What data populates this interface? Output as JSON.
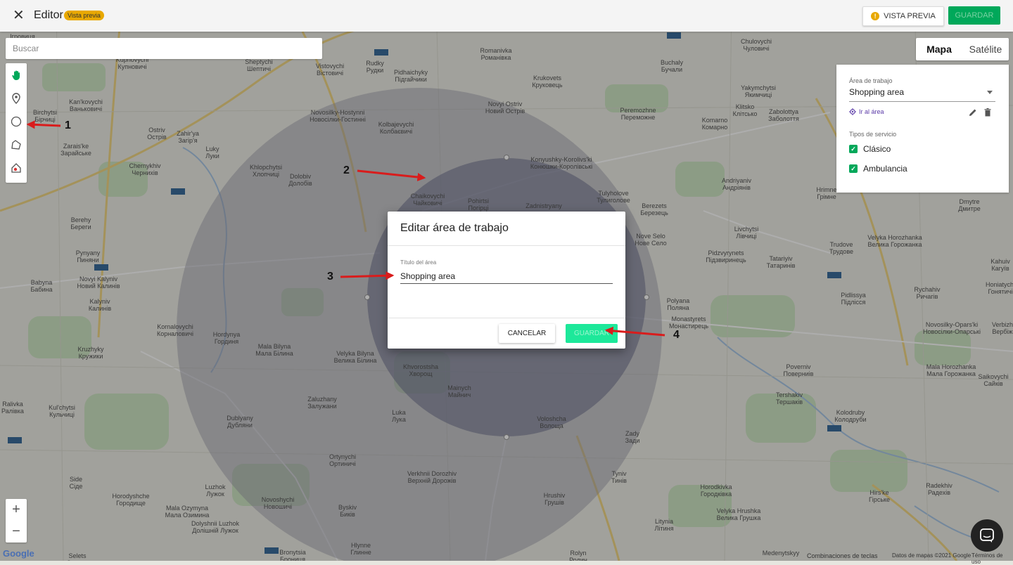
{
  "topbar": {
    "title": "Editor",
    "badge": "Vista previa",
    "preview_button": "VISTA PREVIA",
    "save_button": "GUARDAR"
  },
  "search": {
    "placeholder": "Buscar"
  },
  "map_type": {
    "map": "Mapa",
    "satellite": "Satélite"
  },
  "panel": {
    "area_label": "Área de trabajo",
    "area_value": "Shopping area",
    "goto": "Ir al área",
    "service_label": "Tipos de servicio",
    "services": [
      "Clásico",
      "Ambulancia"
    ]
  },
  "dialog": {
    "title": "Editar área de trabajo",
    "field_label": "Título del área",
    "field_value": "Shopping area",
    "cancel": "CANCELAR",
    "save": "GUARDAR"
  },
  "annotations": [
    "1",
    "2",
    "3",
    "4"
  ],
  "footer": {
    "google": "Google",
    "shortcuts": "Combinaciones de teclas",
    "map_data": "Datos de mapas ©2021 Google",
    "terms": "Términos de uso"
  },
  "places": [
    {
      "name": "Ігровиця"
    },
    {
      "name": "Kupnovychi\nКупновичі"
    },
    {
      "name": "Kan'kovychi\nВаньковичі"
    },
    {
      "name": "Birchytsi\nБірчиці"
    },
    {
      "name": "Ostriv\nОстрів"
    },
    {
      "name": "Zahir'ya\nЗагір'я"
    },
    {
      "name": "Zarais'ke\nЗарайське"
    },
    {
      "name": "Luky\nЛуки"
    },
    {
      "name": "Chernykhiv\nЧернихів"
    },
    {
      "name": "Khlopchytsi\nХлопчиці"
    },
    {
      "name": "Dolobiv\nДолобів"
    },
    {
      "name": "Berehy\nБереги"
    },
    {
      "name": "Pynyany\nПиняни"
    },
    {
      "name": "Babyna\nБабина"
    },
    {
      "name": "Novyi Kalyniv\nНовий Калинів"
    },
    {
      "name": "Kalyniv\nКалинів"
    },
    {
      "name": "Kornalovychi\nКорналовичі"
    },
    {
      "name": "Hordynya\nГординя"
    },
    {
      "name": "Mala Bilyna\nМала Білина"
    },
    {
      "name": "Velyka Bilyna\nВелика Білина"
    },
    {
      "name": "Kruzhyky\nКружики"
    },
    {
      "name": "Ralivka\nРалівка"
    },
    {
      "name": "Kul'chytsi\nКульчиці"
    },
    {
      "name": "Zaluzhany\nЗалужани"
    },
    {
      "name": "Dublyany\nДубляни"
    },
    {
      "name": "Luka\nЛука"
    },
    {
      "name": "Ortynychi\nОртиничі"
    },
    {
      "name": "Side\nСіде"
    },
    {
      "name": "Horodyshche\nГородище"
    },
    {
      "name": "Mala Ozymyna\nМала Озимина"
    },
    {
      "name": "Novoshychi\nНовошичі"
    },
    {
      "name": "Byskiv\nБиків"
    },
    {
      "name": "Luzhok\nЛужок"
    },
    {
      "name": "Dolyshnii Luzhok\nДолішній Лужок"
    },
    {
      "name": "Selets\nСелець"
    },
    {
      "name": "Bronytsia\nБрониця"
    },
    {
      "name": "Hlynne\nГлинне"
    },
    {
      "name": "Verkhnii Dorozhiv\nВерхній Дорожів"
    },
    {
      "name": "Mainych\nМайнич"
    },
    {
      "name": "Khvorostsha\nХворощ"
    },
    {
      "name": "Voloshcha\nВолоща"
    },
    {
      "name": "Zady\nЗади"
    },
    {
      "name": "Tyniv\nТинів"
    },
    {
      "name": "Hrushiv\nГрушів"
    },
    {
      "name": "Rolyn\nРолин"
    },
    {
      "name": "Velyka Hrushka\nВелика Грушка"
    },
    {
      "name": "Litynia\nЛітиня"
    },
    {
      "name": "Horodkivka\nГородківка"
    },
    {
      "name": "Medenytskyy"
    },
    {
      "name": "Rudky\nРудки"
    },
    {
      "name": "Vistovychi\nВістовичі"
    },
    {
      "name": "Sheptychi\nШептичі"
    },
    {
      "name": "Romanivka\nРоманівка"
    },
    {
      "name": "Pidhaichyky\nПідгайчики"
    },
    {
      "name": "Novosilky-Hostynni\nНовосілки-Гостинні"
    },
    {
      "name": "Kolbajevychi\nКолбаєвичі"
    },
    {
      "name": "Novyi Ostriv\nНовий Острів"
    },
    {
      "name": "Krukovets\nКруковець"
    },
    {
      "name": "Konyushky-Korolivs'ki\nКонюшки-Королівські"
    },
    {
      "name": "Chaikovychi\nЧайковичі"
    },
    {
      "name": "Pohirtsi\nПогірці"
    },
    {
      "name": "Tulyholove\nТулиголове"
    },
    {
      "name": "Zadnistryany"
    },
    {
      "name": "Berezets\nБерезець"
    },
    {
      "name": "Nove Selo\nНове Село"
    },
    {
      "name": "Polyana\nПоляна"
    },
    {
      "name": "Monastyrets\nМонастирець"
    },
    {
      "name": "Buchaly\nБучали"
    },
    {
      "name": "Chulovychi\nЧуловичі"
    },
    {
      "name": "Yakymchytsi\nЯкимчиці"
    },
    {
      "name": "Klitsko\nКлітсько"
    },
    {
      "name": "Zabolottya\nЗаболоття"
    },
    {
      "name": "Komarno\nКомарно"
    },
    {
      "name": "Peremozhne\nПереможне"
    },
    {
      "name": "Andriyaniv\nАндріянів"
    },
    {
      "name": "Livchytsi\nЛівчиці"
    },
    {
      "name": "Pidzvyrynets\nПідзвиринець"
    },
    {
      "name": "Tatariyiv\nТатаринів"
    },
    {
      "name": "Hrimne\nГрімне"
    },
    {
      "name": "Dmytre\nДмитре"
    },
    {
      "name": "Trudove\nТрудове"
    },
    {
      "name": "Velyka Horozhanka\nВелика Горожанка"
    },
    {
      "name": "Kahuiv\nКагуїв"
    },
    {
      "name": "Pidlissya\nПідлісся"
    },
    {
      "name": "Rychahiv\nРичагів"
    },
    {
      "name": "Honiatychi\nГонятичі"
    },
    {
      "name": "Novosilky-Opars'ki\nНовосілки-Опарські"
    },
    {
      "name": "Verbizh\nВербіж"
    },
    {
      "name": "Poverniv\nПоверниів"
    },
    {
      "name": "Tershakiv\nТершаків"
    },
    {
      "name": "Mala Horozhanka\nМала Горожанка"
    },
    {
      "name": "Saikovychi\nСайків"
    },
    {
      "name": "Kolodruby\nКолодруби"
    },
    {
      "name": "Radekhiv\nРадехів"
    },
    {
      "name": "Hirs'ke\nГірське"
    }
  ]
}
